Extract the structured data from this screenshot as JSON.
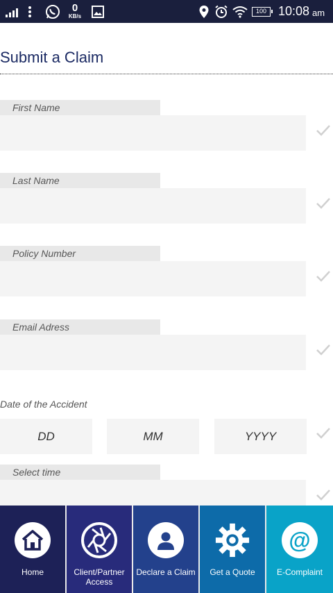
{
  "status_bar": {
    "net_speed_value": "0",
    "net_speed_unit": "KB/s",
    "battery": "100",
    "time": "10:08",
    "ampm": "am",
    "icons": [
      "signal-icon",
      "more-vert-icon",
      "whatsapp-icon",
      "gallery-icon",
      "location-icon",
      "alarm-icon",
      "wifi-icon",
      "battery-icon"
    ]
  },
  "page": {
    "title": "Submit a Claim"
  },
  "form": {
    "first_name_label": "First Name",
    "last_name_label": "Last Name",
    "policy_number_label": "Policy Number",
    "email_label": "Email Adress",
    "date_label": "Date of the Accident",
    "date_dd": "DD",
    "date_mm": "MM",
    "date_yyyy": "YYYY",
    "select_time_label": "Select time"
  },
  "bottom_nav": {
    "items": [
      {
        "label": "Home",
        "icon": "home-icon"
      },
      {
        "label": "Client/Partner Access",
        "icon": "shutter-icon"
      },
      {
        "label": "Declare a Claim",
        "icon": "user-icon"
      },
      {
        "label": "Get a Quote",
        "icon": "gear-icon"
      },
      {
        "label": "E-Complaint",
        "icon": "at-icon"
      }
    ]
  },
  "colors": {
    "status_bar": "#1a1f3d",
    "title": "#1b2a63",
    "nav_home": "#1d2157",
    "nav_client": "#282b7b",
    "nav_claim": "#23418c",
    "nav_quote": "#0d6ba9",
    "nav_complaint": "#09a3c8",
    "check": "#d0d0d0"
  }
}
